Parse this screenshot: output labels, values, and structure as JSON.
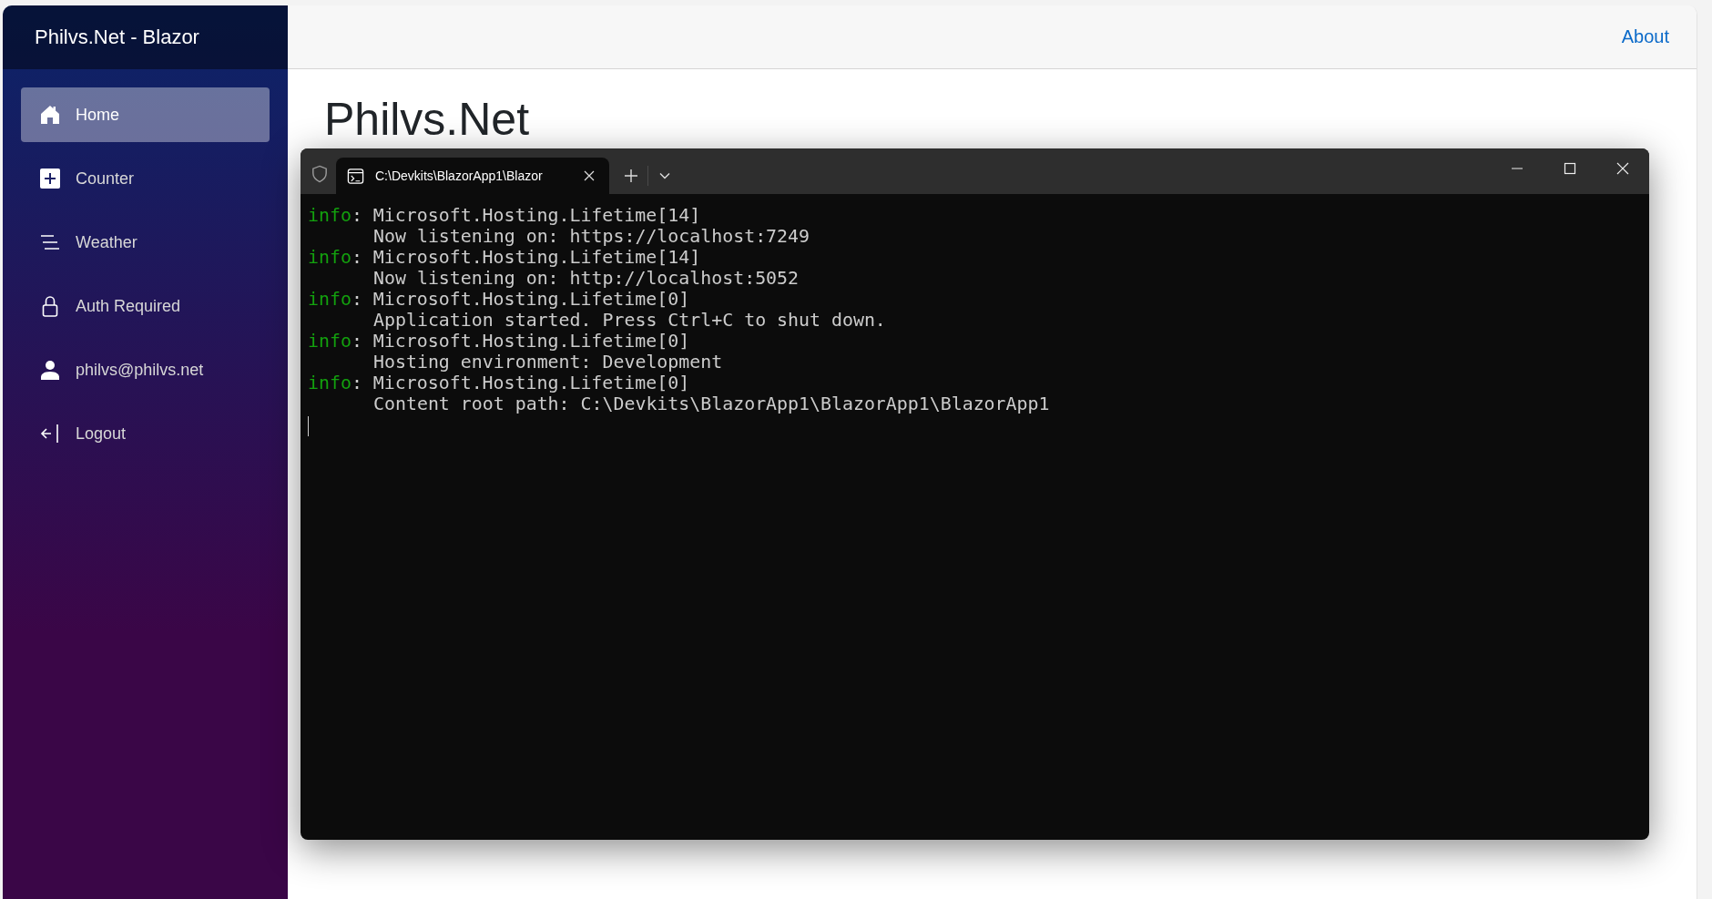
{
  "sidebar": {
    "brand": "Philvs.Net - Blazor",
    "items": [
      {
        "kind": "home",
        "label": "Home",
        "selected": true
      },
      {
        "kind": "plus",
        "label": "Counter",
        "selected": false
      },
      {
        "kind": "lines",
        "label": "Weather",
        "selected": false
      },
      {
        "kind": "lock",
        "label": "Auth Required",
        "selected": false
      },
      {
        "kind": "person",
        "label": "philvs@philvs.net",
        "selected": false
      },
      {
        "kind": "logout",
        "label": "Logout",
        "selected": false
      }
    ]
  },
  "top_bar": {
    "links": [
      "About"
    ]
  },
  "main": {
    "heading": "Philvs.Net"
  },
  "terminal": {
    "tabs": [
      {
        "title": "C:\\Devkits\\BlazorApp1\\Blazor",
        "selected": true
      }
    ],
    "log_entries": [
      {
        "level": "info",
        "source": ": Microsoft.Hosting.Lifetime[14]",
        "message": "Now listening on: https://localhost:7249"
      },
      {
        "level": "info",
        "source": ": Microsoft.Hosting.Lifetime[14]",
        "message": "Now listening on: http://localhost:5052"
      },
      {
        "level": "info",
        "source": ": Microsoft.Hosting.Lifetime[0]",
        "message": "Application started. Press Ctrl+C to shut down."
      },
      {
        "level": "info",
        "source": ": Microsoft.Hosting.Lifetime[0]",
        "message": "Hosting environment: Development"
      },
      {
        "level": "info",
        "source": ": Microsoft.Hosting.Lifetime[0]",
        "message": "Content root path: C:\\Devkits\\BlazorApp1\\BlazorApp1\\BlazorApp1"
      }
    ]
  }
}
